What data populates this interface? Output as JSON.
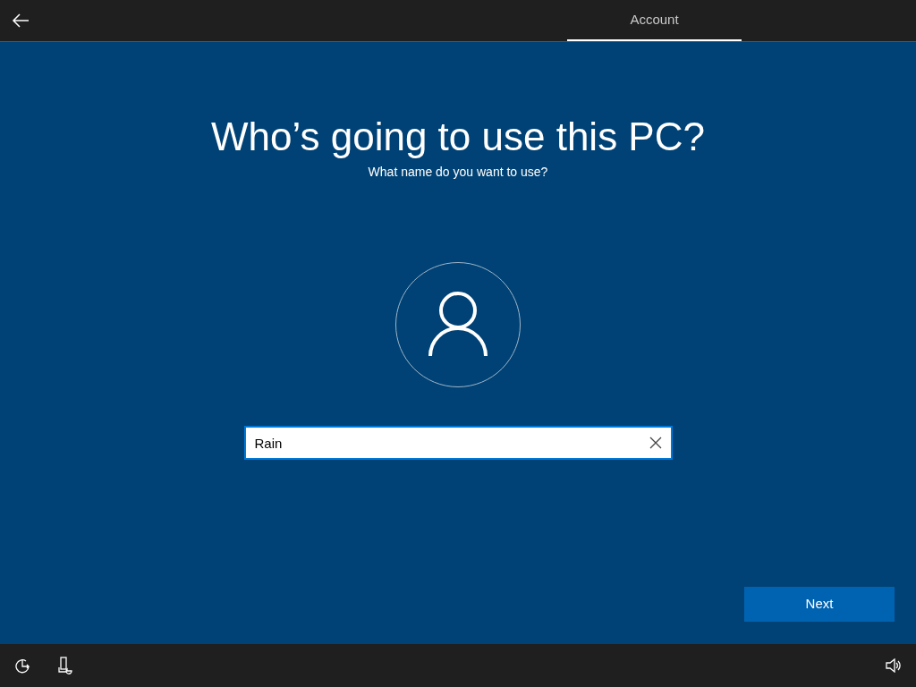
{
  "header": {
    "tabs": [
      {
        "label": "Account",
        "selected": true
      }
    ]
  },
  "title": "Who’s going to use this PC?",
  "subtitle": "What name do you want to use?",
  "name_field": {
    "value": "Rain"
  },
  "next_button": "Next"
}
